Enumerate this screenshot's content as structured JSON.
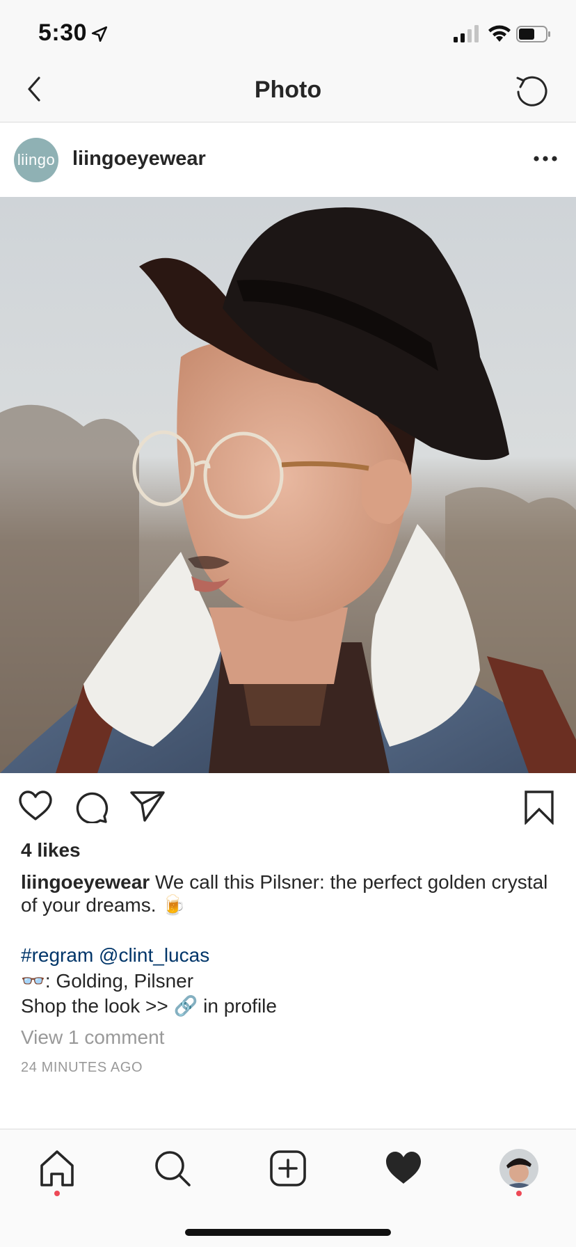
{
  "status_bar": {
    "time": "5:30"
  },
  "nav": {
    "title": "Photo"
  },
  "post": {
    "username": "liingoeyewear",
    "avatar_text": "liingo",
    "likes": "4 likes",
    "caption_user": "liingoeyewear",
    "caption_text": " We call this Pilsner: the perfect golden crystal of your dreams. 🍺",
    "hashtag_line": "#regram @clint_lucas",
    "gear_line": "👓: Golding, Pilsner",
    "shop_line": "Shop the look >> 🔗 in profile",
    "view_comments": "View 1 comment",
    "timestamp": "24 MINUTES AGO"
  },
  "colors": {
    "link_blue": "#003569",
    "notification_red": "#ed4956",
    "avatar_teal": "#8fb1b4",
    "muted_gray": "#999999"
  },
  "icons": {
    "status": [
      "location-arrow-icon",
      "signal-icon",
      "wifi-icon",
      "battery-icon"
    ],
    "nav": [
      "back-chevron-icon",
      "refresh-icon"
    ],
    "actions": [
      "heart-outline-icon",
      "comment-icon",
      "share-paper-plane-icon",
      "bookmark-icon"
    ],
    "tabs": [
      "home-icon",
      "search-icon",
      "new-post-icon",
      "activity-heart-icon",
      "profile-avatar"
    ]
  }
}
